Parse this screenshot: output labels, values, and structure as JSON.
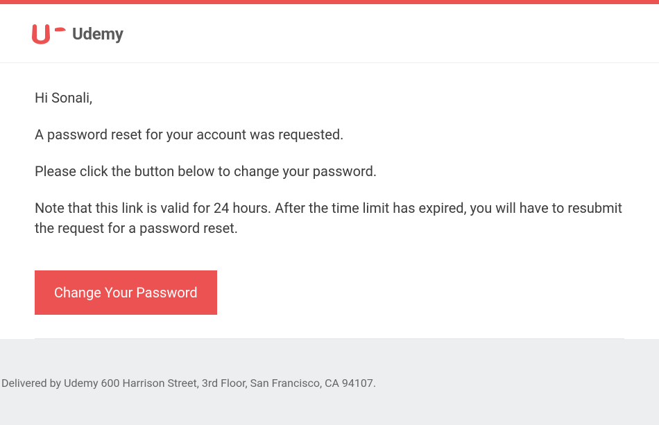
{
  "brand": {
    "name": "Udemy",
    "accent": "#ec5252"
  },
  "email": {
    "greeting": "Hi Sonali,",
    "line1": "A password reset for your account was requested.",
    "line2": "Please click the button below to change your password.",
    "line3": "Note that this link is valid for 24 hours. After the time limit has expired, you will have to resubmit the request for a password reset.",
    "cta_label": "Change Your Password"
  },
  "footer": {
    "text": "Delivered by Udemy 600 Harrison Street, 3rd Floor, San Francisco, CA 94107."
  }
}
